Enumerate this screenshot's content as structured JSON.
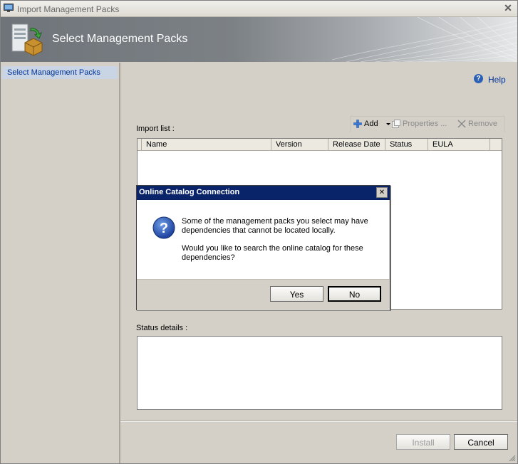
{
  "window": {
    "title": "Import Management Packs",
    "close_glyph": "✕"
  },
  "banner": {
    "title": "Select Management Packs"
  },
  "sidebar": {
    "items": [
      {
        "label": "Select Management Packs"
      }
    ]
  },
  "help": {
    "label": "Help",
    "glyph": "?"
  },
  "import_list": {
    "label": "Import list :",
    "toolbar": {
      "add": "Add",
      "properties": "Properties ...",
      "remove": "Remove"
    },
    "columns": [
      "Name",
      "Version",
      "Release Date",
      "Status",
      "EULA"
    ]
  },
  "status_details": {
    "label": "Status details :"
  },
  "footer": {
    "install": "Install",
    "cancel": "Cancel"
  },
  "dialog": {
    "title": "Online Catalog Connection",
    "close_glyph": "✕",
    "message_line1": "Some of the management packs you select may have dependencies that cannot be located locally.",
    "message_line2": "Would you like to search the online catalog for these dependencies?",
    "yes": "Yes",
    "no": "No"
  },
  "colors": {
    "dialog_title_bg": "#0a246a",
    "link": "#003399",
    "selection": "#c9d5e4"
  }
}
